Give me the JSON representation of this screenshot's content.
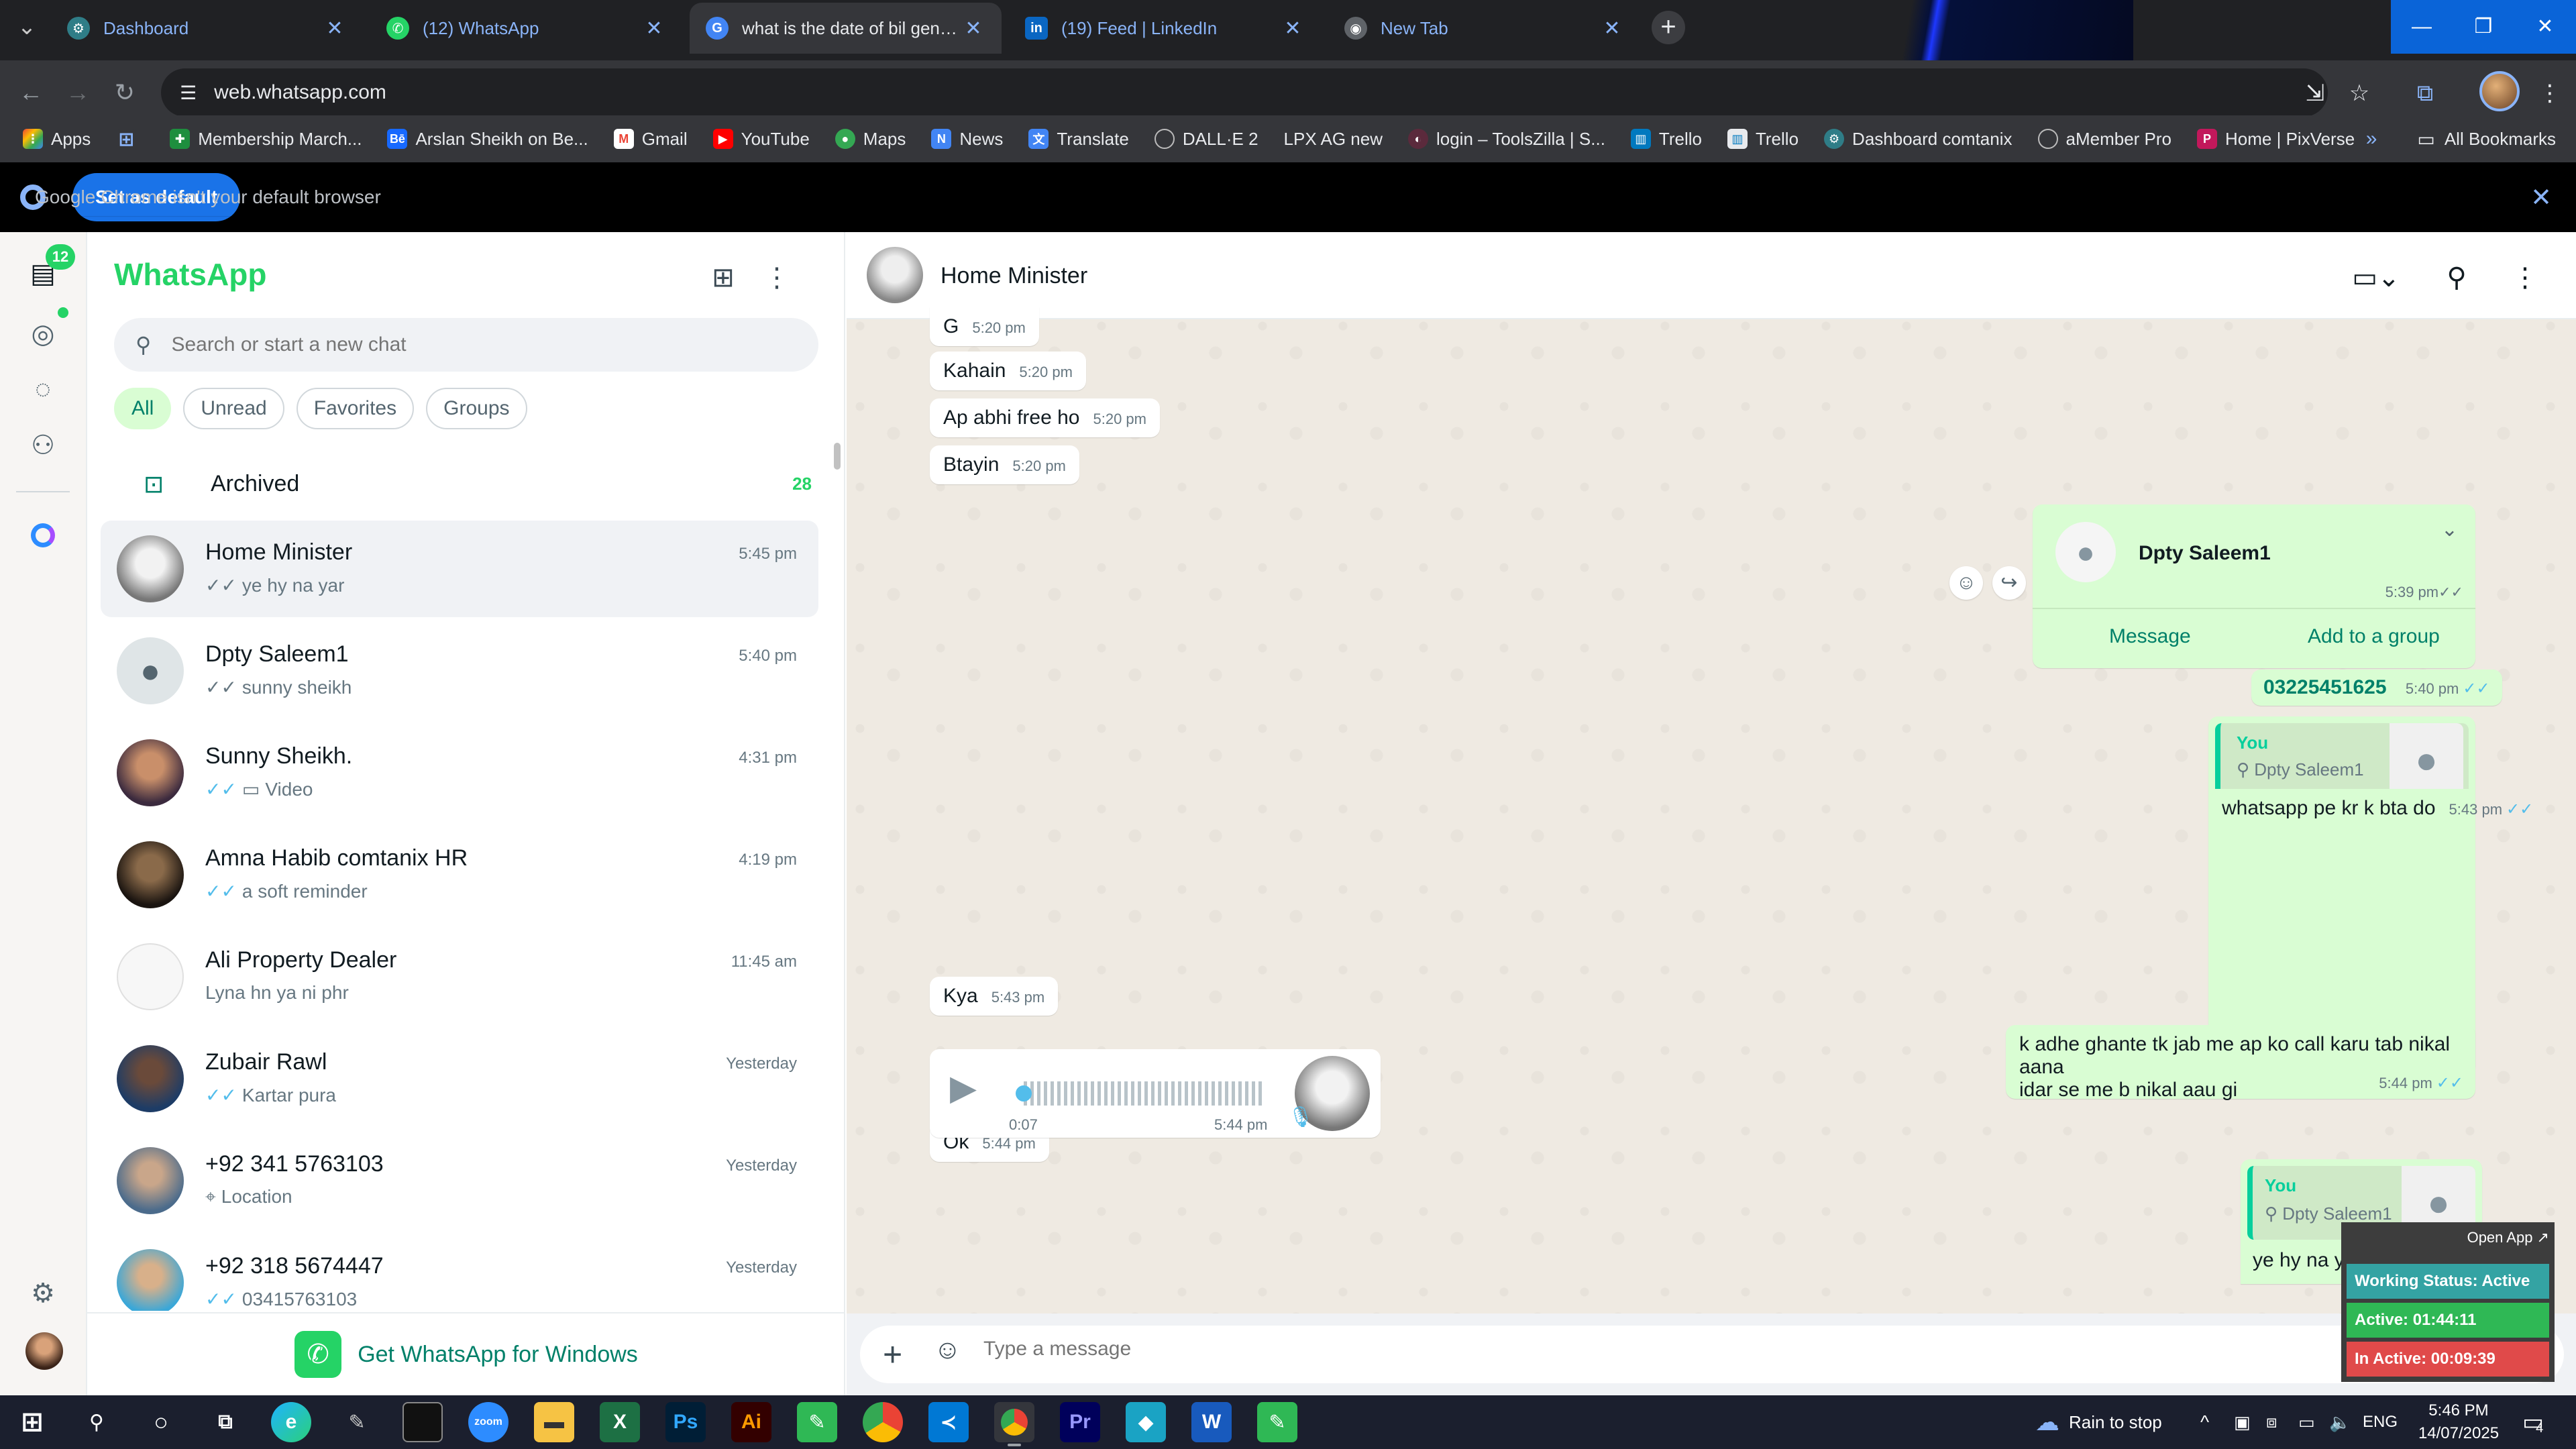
{
  "browser": {
    "tabs": [
      {
        "title": "Dashboard",
        "icon": "gear-icon"
      },
      {
        "title": "(12) WhatsApp",
        "icon": "whatsapp-icon"
      },
      {
        "title": "what is the date of bil generati",
        "icon": "google-icon"
      },
      {
        "title": "(19) Feed | LinkedIn",
        "icon": "linkedin-icon"
      },
      {
        "title": "New Tab",
        "icon": "chrome-icon"
      }
    ],
    "active_tab": 2,
    "url": "web.whatsapp.com",
    "bookmarks": [
      "Apps",
      "Membership March...",
      "Arslan Sheikh on Be...",
      "Gmail",
      "YouTube",
      "Maps",
      "News",
      "Translate",
      "DALL·E 2",
      "LPX AG new",
      "login – ToolsZilla | S...",
      "Trello",
      "Trello",
      "Dashboard comtanix",
      "aMember Pro",
      "Home | PixVerse"
    ],
    "all_bookmarks": "All Bookmarks",
    "infobar": {
      "message": "Google Chrome isn't your default browser",
      "button": "Set as default"
    }
  },
  "whatsapp": {
    "rail_badge": "12",
    "title": "WhatsApp",
    "search_placeholder": "Search or start a new chat",
    "filters": [
      "All",
      "Unread",
      "Favorites",
      "Groups"
    ],
    "archived": {
      "label": "Archived",
      "count": "28"
    },
    "chats": [
      {
        "name": "Home Minister",
        "time": "5:45 pm",
        "preview": "ye hy na yar",
        "tick": "grey",
        "selected": true
      },
      {
        "name": "Dpty Saleem1",
        "time": "5:40 pm",
        "preview": "sunny sheikh",
        "tick": "grey"
      },
      {
        "name": "Sunny Sheikh.",
        "time": "4:31 pm",
        "preview": "Video",
        "tick": "blue"
      },
      {
        "name": "Amna Habib comtanix HR",
        "time": "4:19 pm",
        "preview": "a soft reminder",
        "tick": "blue"
      },
      {
        "name": "Ali Property Dealer",
        "time": "11:45 am",
        "preview": "Lyna hn ya ni phr",
        "tick": ""
      },
      {
        "name": "Zubair Rawl",
        "time": "Yesterday",
        "preview": "Kartar pura",
        "tick": "blue"
      },
      {
        "name": "+92 341 5763103",
        "time": "Yesterday",
        "preview": "Location",
        "tick": ""
      },
      {
        "name": "+92 318 5674447",
        "time": "Yesterday",
        "preview": "03415763103",
        "tick": "blue"
      }
    ],
    "get_app": "Get WhatsApp for Windows",
    "conversation": {
      "contact": "Home Minister",
      "incoming_top": [
        {
          "text": "G",
          "time": "5:20 pm"
        },
        {
          "text": "Kahain",
          "time": "5:20 pm"
        },
        {
          "text": "Ap abhi free ho",
          "time": "5:20 pm"
        },
        {
          "text": "Btayin",
          "time": "5:20 pm"
        }
      ],
      "contact_card": {
        "name": "Dpty Saleem1",
        "time": "5:39 pm",
        "message": "Message",
        "add_group": "Add to a group"
      },
      "phone_msg": {
        "text": "03225451625",
        "time": "5:40 pm"
      },
      "reply1": {
        "you": "You",
        "quoted": "Dpty Saleem1",
        "text": "whatsapp pe kr k bta do",
        "time": "5:43 pm"
      },
      "kya": {
        "text": "Kya",
        "time": "5:43 pm"
      },
      "long_msg": {
        "line1": "k adhe ghante tk jab me ap ko call karu tab nikal aana",
        "line2": "idar se me b nikal aau gi",
        "time": "5:44 pm"
      },
      "ok": {
        "text": "Ok",
        "time": "5:44 pm"
      },
      "voice": {
        "duration": "0:07",
        "time": "5:44 pm"
      },
      "reply2": {
        "you": "You",
        "quoted": "Dpty Saleem1",
        "text": "ye hy na yar"
      },
      "composer_placeholder": "Type a message"
    },
    "widget": {
      "open": "Open App ↗",
      "status": "Working Status: Active",
      "active": "Active: 01:44:11",
      "inactive": "In Active: 00:09:39"
    }
  },
  "taskbar": {
    "weather": "Rain to stop",
    "lang": "ENG",
    "time": "5:46 PM",
    "date": "14/07/2025",
    "notif": "4"
  }
}
